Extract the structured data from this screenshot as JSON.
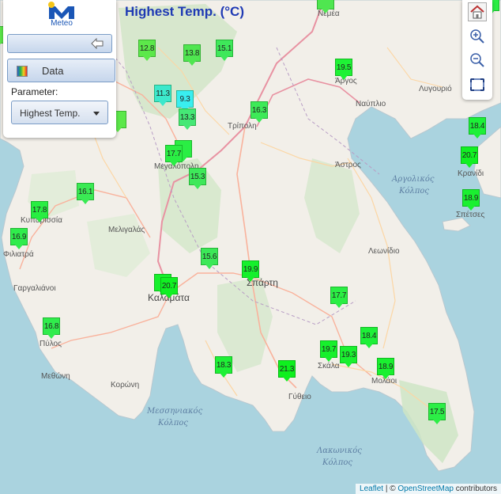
{
  "app": {
    "logo_text": "Meteo",
    "map_title": "Highest Temp. (°C)"
  },
  "panel": {
    "data_button": "Data",
    "parameter_label": "Parameter:",
    "parameter_value": "Highest Temp."
  },
  "toolbar": {
    "icons": [
      "home-icon",
      "zoom-in-icon",
      "zoom-out-icon",
      "fullscreen-icon"
    ]
  },
  "place_labels": [
    {
      "text": "Νεμέα"
    },
    {
      "text": "Άργος"
    },
    {
      "text": "Λυγουριό"
    },
    {
      "text": "Ναύπλιο"
    },
    {
      "text": "Τρίπολη"
    },
    {
      "text": "Άστρος"
    },
    {
      "text": "Μεγαλόπολη"
    },
    {
      "text": "Κυπαρισσία"
    },
    {
      "text": "Μελιγαλάς"
    },
    {
      "text": "Φιλιατρά"
    },
    {
      "text": "Γαργαλιάνοι"
    },
    {
      "text": "Καλαμάτα"
    },
    {
      "text": "Σπάρτη"
    },
    {
      "text": "Λεωνίδιο"
    },
    {
      "text": "Πύλος"
    },
    {
      "text": "Μεθώνη"
    },
    {
      "text": "Κορώνη"
    },
    {
      "text": "Σκάλα"
    },
    {
      "text": "Μολάοι"
    },
    {
      "text": "Γύθειο"
    },
    {
      "text": "Κρανίδι"
    },
    {
      "text": "Σπέτσες"
    }
  ],
  "sea_labels": [
    {
      "text": "Αργολικός"
    },
    {
      "text": "Κόλπος"
    },
    {
      "text": "Μεσσηνιακός"
    },
    {
      "text": "Κόλπος"
    },
    {
      "text": "Λακωνικός"
    },
    {
      "text": "Κόλπος"
    }
  ],
  "stations": [
    {
      "value": "12.8",
      "color": "#5ce84a"
    },
    {
      "value": "13.8",
      "color": "#4fe650"
    },
    {
      "value": "15.1",
      "color": "#3ee85a"
    },
    {
      "value": "19.5",
      "color": "#1ef235"
    },
    {
      "value": "11.3",
      "color": "#3ce8cc"
    },
    {
      "value": "9.3",
      "color": "#39eef0"
    },
    {
      "value": "13.3",
      "color": "#45e876"
    },
    {
      "value": "16.3",
      "color": "#3dea58"
    },
    {
      "value": "18.4",
      "color": "#1df038"
    },
    {
      "value": "17.7",
      "color": "#2aee44"
    },
    {
      "value": "15.3",
      "color": "#3ee85a"
    },
    {
      "value": "20.7",
      "color": "#11f023"
    },
    {
      "value": "18.9",
      "color": "#1af030"
    },
    {
      "value": "16.1",
      "color": "#3aea54"
    },
    {
      "value": "17.8",
      "color": "#28ee42"
    },
    {
      "value": "16.9",
      "color": "#30ec4c"
    },
    {
      "value": "15.6",
      "color": "#3ce858"
    },
    {
      "value": "19.9",
      "color": "#16f02c"
    },
    {
      "value": "20.7",
      "color": "#11f023"
    },
    {
      "value": "17.7",
      "color": "#2aee44"
    },
    {
      "value": "16.8",
      "color": "#30ec4c"
    },
    {
      "value": "18.4",
      "color": "#1df038"
    },
    {
      "value": "19.7",
      "color": "#16f02c"
    },
    {
      "value": "19.3",
      "color": "#1af030"
    },
    {
      "value": "18.9",
      "color": "#1af030"
    },
    {
      "value": "18.3",
      "color": "#1ef036"
    },
    {
      "value": "21.3",
      "color": "#0ef01e"
    },
    {
      "value": "17.5",
      "color": "#2cee46"
    }
  ],
  "attribution": {
    "leaflet": "Leaflet",
    "sep": " | © ",
    "osm": "OpenStreetMap",
    "suffix": " contributors"
  }
}
